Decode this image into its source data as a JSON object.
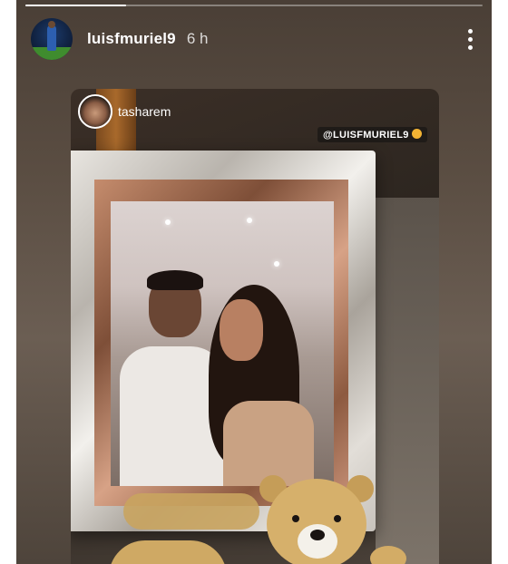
{
  "story": {
    "progress_fraction": 0.22,
    "author": {
      "username": "luisfmuriel9",
      "time_ago": "6 h",
      "avatar_icon": "profile-avatar"
    },
    "more_icon": "more-vertical-icon"
  },
  "shared_post": {
    "username": "tasharem",
    "avatar_icon": "profile-avatar",
    "mention_tag": "@LUISFMURIEL9"
  },
  "colors": {
    "background": "#ffffff",
    "story_bg": "#5a4d42",
    "text": "#ffffff",
    "mention_bg": "#1f1b18"
  }
}
